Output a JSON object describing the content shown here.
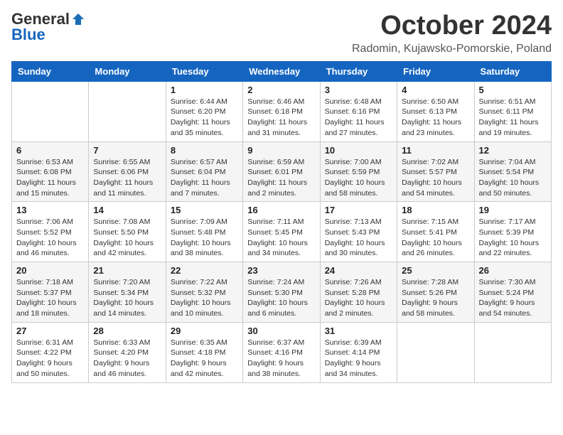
{
  "logo": {
    "general": "General",
    "blue": "Blue"
  },
  "header": {
    "month": "October 2024",
    "location": "Radomin, Kujawsko-Pomorskie, Poland"
  },
  "weekdays": [
    "Sunday",
    "Monday",
    "Tuesday",
    "Wednesday",
    "Thursday",
    "Friday",
    "Saturday"
  ],
  "weeks": [
    [
      {
        "day": "",
        "detail": ""
      },
      {
        "day": "",
        "detail": ""
      },
      {
        "day": "1",
        "detail": "Sunrise: 6:44 AM\nSunset: 6:20 PM\nDaylight: 11 hours and 35 minutes."
      },
      {
        "day": "2",
        "detail": "Sunrise: 6:46 AM\nSunset: 6:18 PM\nDaylight: 11 hours and 31 minutes."
      },
      {
        "day": "3",
        "detail": "Sunrise: 6:48 AM\nSunset: 6:16 PM\nDaylight: 11 hours and 27 minutes."
      },
      {
        "day": "4",
        "detail": "Sunrise: 6:50 AM\nSunset: 6:13 PM\nDaylight: 11 hours and 23 minutes."
      },
      {
        "day": "5",
        "detail": "Sunrise: 6:51 AM\nSunset: 6:11 PM\nDaylight: 11 hours and 19 minutes."
      }
    ],
    [
      {
        "day": "6",
        "detail": "Sunrise: 6:53 AM\nSunset: 6:08 PM\nDaylight: 11 hours and 15 minutes."
      },
      {
        "day": "7",
        "detail": "Sunrise: 6:55 AM\nSunset: 6:06 PM\nDaylight: 11 hours and 11 minutes."
      },
      {
        "day": "8",
        "detail": "Sunrise: 6:57 AM\nSunset: 6:04 PM\nDaylight: 11 hours and 7 minutes."
      },
      {
        "day": "9",
        "detail": "Sunrise: 6:59 AM\nSunset: 6:01 PM\nDaylight: 11 hours and 2 minutes."
      },
      {
        "day": "10",
        "detail": "Sunrise: 7:00 AM\nSunset: 5:59 PM\nDaylight: 10 hours and 58 minutes."
      },
      {
        "day": "11",
        "detail": "Sunrise: 7:02 AM\nSunset: 5:57 PM\nDaylight: 10 hours and 54 minutes."
      },
      {
        "day": "12",
        "detail": "Sunrise: 7:04 AM\nSunset: 5:54 PM\nDaylight: 10 hours and 50 minutes."
      }
    ],
    [
      {
        "day": "13",
        "detail": "Sunrise: 7:06 AM\nSunset: 5:52 PM\nDaylight: 10 hours and 46 minutes."
      },
      {
        "day": "14",
        "detail": "Sunrise: 7:08 AM\nSunset: 5:50 PM\nDaylight: 10 hours and 42 minutes."
      },
      {
        "day": "15",
        "detail": "Sunrise: 7:09 AM\nSunset: 5:48 PM\nDaylight: 10 hours and 38 minutes."
      },
      {
        "day": "16",
        "detail": "Sunrise: 7:11 AM\nSunset: 5:45 PM\nDaylight: 10 hours and 34 minutes."
      },
      {
        "day": "17",
        "detail": "Sunrise: 7:13 AM\nSunset: 5:43 PM\nDaylight: 10 hours and 30 minutes."
      },
      {
        "day": "18",
        "detail": "Sunrise: 7:15 AM\nSunset: 5:41 PM\nDaylight: 10 hours and 26 minutes."
      },
      {
        "day": "19",
        "detail": "Sunrise: 7:17 AM\nSunset: 5:39 PM\nDaylight: 10 hours and 22 minutes."
      }
    ],
    [
      {
        "day": "20",
        "detail": "Sunrise: 7:18 AM\nSunset: 5:37 PM\nDaylight: 10 hours and 18 minutes."
      },
      {
        "day": "21",
        "detail": "Sunrise: 7:20 AM\nSunset: 5:34 PM\nDaylight: 10 hours and 14 minutes."
      },
      {
        "day": "22",
        "detail": "Sunrise: 7:22 AM\nSunset: 5:32 PM\nDaylight: 10 hours and 10 minutes."
      },
      {
        "day": "23",
        "detail": "Sunrise: 7:24 AM\nSunset: 5:30 PM\nDaylight: 10 hours and 6 minutes."
      },
      {
        "day": "24",
        "detail": "Sunrise: 7:26 AM\nSunset: 5:28 PM\nDaylight: 10 hours and 2 minutes."
      },
      {
        "day": "25",
        "detail": "Sunrise: 7:28 AM\nSunset: 5:26 PM\nDaylight: 9 hours and 58 minutes."
      },
      {
        "day": "26",
        "detail": "Sunrise: 7:30 AM\nSunset: 5:24 PM\nDaylight: 9 hours and 54 minutes."
      }
    ],
    [
      {
        "day": "27",
        "detail": "Sunrise: 6:31 AM\nSunset: 4:22 PM\nDaylight: 9 hours and 50 minutes."
      },
      {
        "day": "28",
        "detail": "Sunrise: 6:33 AM\nSunset: 4:20 PM\nDaylight: 9 hours and 46 minutes."
      },
      {
        "day": "29",
        "detail": "Sunrise: 6:35 AM\nSunset: 4:18 PM\nDaylight: 9 hours and 42 minutes."
      },
      {
        "day": "30",
        "detail": "Sunrise: 6:37 AM\nSunset: 4:16 PM\nDaylight: 9 hours and 38 minutes."
      },
      {
        "day": "31",
        "detail": "Sunrise: 6:39 AM\nSunset: 4:14 PM\nDaylight: 9 hours and 34 minutes."
      },
      {
        "day": "",
        "detail": ""
      },
      {
        "day": "",
        "detail": ""
      }
    ]
  ]
}
